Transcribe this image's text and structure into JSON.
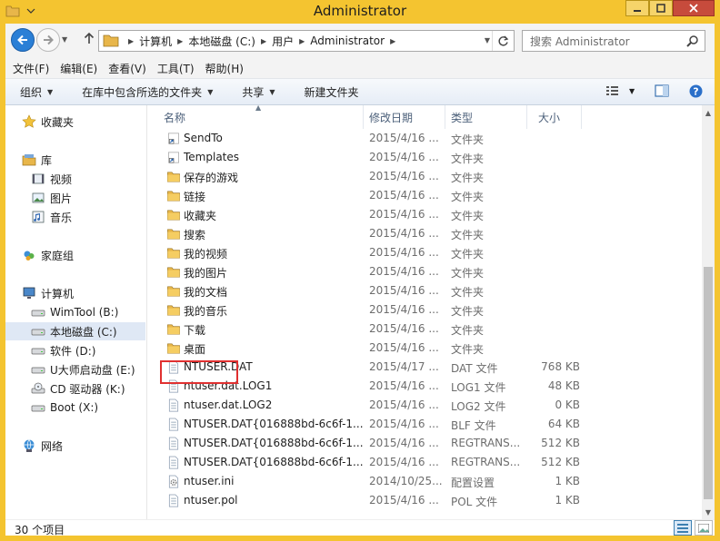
{
  "window": {
    "title": "Administrator"
  },
  "nav": {
    "breadcrumbs": [
      "计算机",
      "本地磁盘 (C:)",
      "用户",
      "Administrator"
    ],
    "search_placeholder": "搜索 Administrator"
  },
  "menu": {
    "items": [
      "文件(F)",
      "编辑(E)",
      "查看(V)",
      "工具(T)",
      "帮助(H)"
    ]
  },
  "toolbar": {
    "organize": "组织",
    "include_in_library": "在库中包含所选的文件夹",
    "share": "共享",
    "new_folder": "新建文件夹"
  },
  "sidebar": {
    "favorites": "收藏夹",
    "library": "库",
    "library_items": [
      "视频",
      "图片",
      "音乐"
    ],
    "homegroup": "家庭组",
    "computer": "计算机",
    "drives": [
      "WimTool (B:)",
      "本地磁盘 (C:)",
      "软件 (D:)",
      "U大师启动盘 (E:)",
      "CD 驱动器 (K:)",
      "Boot (X:)"
    ],
    "network": "网络"
  },
  "columns": {
    "name": "名称",
    "modified": "修改日期",
    "type": "类型",
    "size": "大小"
  },
  "files": [
    {
      "name": "SendTo",
      "date": "2015/4/16 ...",
      "type": "文件夹",
      "size": "",
      "icon": "shortcut-folder"
    },
    {
      "name": "Templates",
      "date": "2015/4/16 ...",
      "type": "文件夹",
      "size": "",
      "icon": "shortcut-folder"
    },
    {
      "name": "保存的游戏",
      "date": "2015/4/16 ...",
      "type": "文件夹",
      "size": "",
      "icon": "folder"
    },
    {
      "name": "链接",
      "date": "2015/4/16 ...",
      "type": "文件夹",
      "size": "",
      "icon": "folder"
    },
    {
      "name": "收藏夹",
      "date": "2015/4/16 ...",
      "type": "文件夹",
      "size": "",
      "icon": "folder"
    },
    {
      "name": "搜索",
      "date": "2015/4/16 ...",
      "type": "文件夹",
      "size": "",
      "icon": "folder"
    },
    {
      "name": "我的视频",
      "date": "2015/4/16 ...",
      "type": "文件夹",
      "size": "",
      "icon": "folder"
    },
    {
      "name": "我的图片",
      "date": "2015/4/16 ...",
      "type": "文件夹",
      "size": "",
      "icon": "folder"
    },
    {
      "name": "我的文档",
      "date": "2015/4/16 ...",
      "type": "文件夹",
      "size": "",
      "icon": "folder"
    },
    {
      "name": "我的音乐",
      "date": "2015/4/16 ...",
      "type": "文件夹",
      "size": "",
      "icon": "folder"
    },
    {
      "name": "下载",
      "date": "2015/4/16 ...",
      "type": "文件夹",
      "size": "",
      "icon": "folder"
    },
    {
      "name": "桌面",
      "date": "2015/4/16 ...",
      "type": "文件夹",
      "size": "",
      "icon": "folder"
    },
    {
      "name": "NTUSER.DAT",
      "date": "2015/4/17 ...",
      "type": "DAT 文件",
      "size": "768 KB",
      "icon": "file"
    },
    {
      "name": "ntuser.dat.LOG1",
      "date": "2015/4/16 ...",
      "type": "LOG1 文件",
      "size": "48 KB",
      "icon": "file"
    },
    {
      "name": "ntuser.dat.LOG2",
      "date": "2015/4/16 ...",
      "type": "LOG2 文件",
      "size": "0 KB",
      "icon": "file"
    },
    {
      "name": "NTUSER.DAT{016888bd-6c6f-1...",
      "date": "2015/4/16 ...",
      "type": "BLF 文件",
      "size": "64 KB",
      "icon": "file"
    },
    {
      "name": "NTUSER.DAT{016888bd-6c6f-1...",
      "date": "2015/4/16 ...",
      "type": "REGTRANS...",
      "size": "512 KB",
      "icon": "file"
    },
    {
      "name": "NTUSER.DAT{016888bd-6c6f-1...",
      "date": "2015/4/16 ...",
      "type": "REGTRANS...",
      "size": "512 KB",
      "icon": "file"
    },
    {
      "name": "ntuser.ini",
      "date": "2014/10/25...",
      "type": "配置设置",
      "size": "1 KB",
      "icon": "settings-file"
    },
    {
      "name": "ntuser.pol",
      "date": "2015/4/16 ...",
      "type": "POL 文件",
      "size": "1 KB",
      "icon": "file"
    }
  ],
  "status": {
    "item_count": "30 个项目"
  },
  "colors": {
    "titlebar": "#f4c430",
    "selection": "#dfe8f5",
    "header_text": "#4c607a",
    "highlight": "#e03030"
  }
}
